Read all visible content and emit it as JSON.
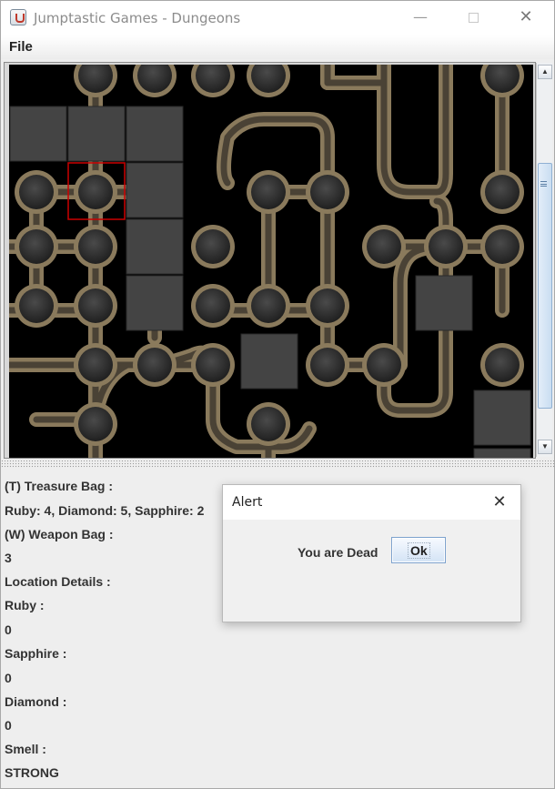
{
  "window": {
    "title": "Jumptastic Games - Dungeons",
    "minimize_glyph": "—",
    "close_glyph": "✕"
  },
  "menu": {
    "file_label": "File"
  },
  "scrollbar": {
    "up_glyph": "▲",
    "down_glyph": "▼"
  },
  "info": {
    "treasure_label": "(T) Treasure Bag :",
    "treasure_value": "Ruby: 4, Diamond: 5, Sapphire: 2",
    "weapon_label": "(W) Weapon Bag :",
    "weapon_value": "3",
    "location_label": "Location Details :",
    "ruby_label": "Ruby :",
    "ruby_value": "0",
    "sapphire_label": "Sapphire :",
    "sapphire_value": "0",
    "diamond_label": "Diamond :",
    "diamond_value": "0",
    "smell_label": "Smell :",
    "smell_value": "STRONG"
  },
  "alert": {
    "title": "Alert",
    "close_glyph": "✕",
    "message": "You are Dead",
    "ok_label": "Ok"
  },
  "colors": {
    "map_background": "#000000",
    "pipe_stone": "#8a7a5c",
    "pipe_dark": "#4a4235",
    "room": "#3d3d3d",
    "room_fill": "#444444",
    "player_highlight": "#cc0000"
  }
}
